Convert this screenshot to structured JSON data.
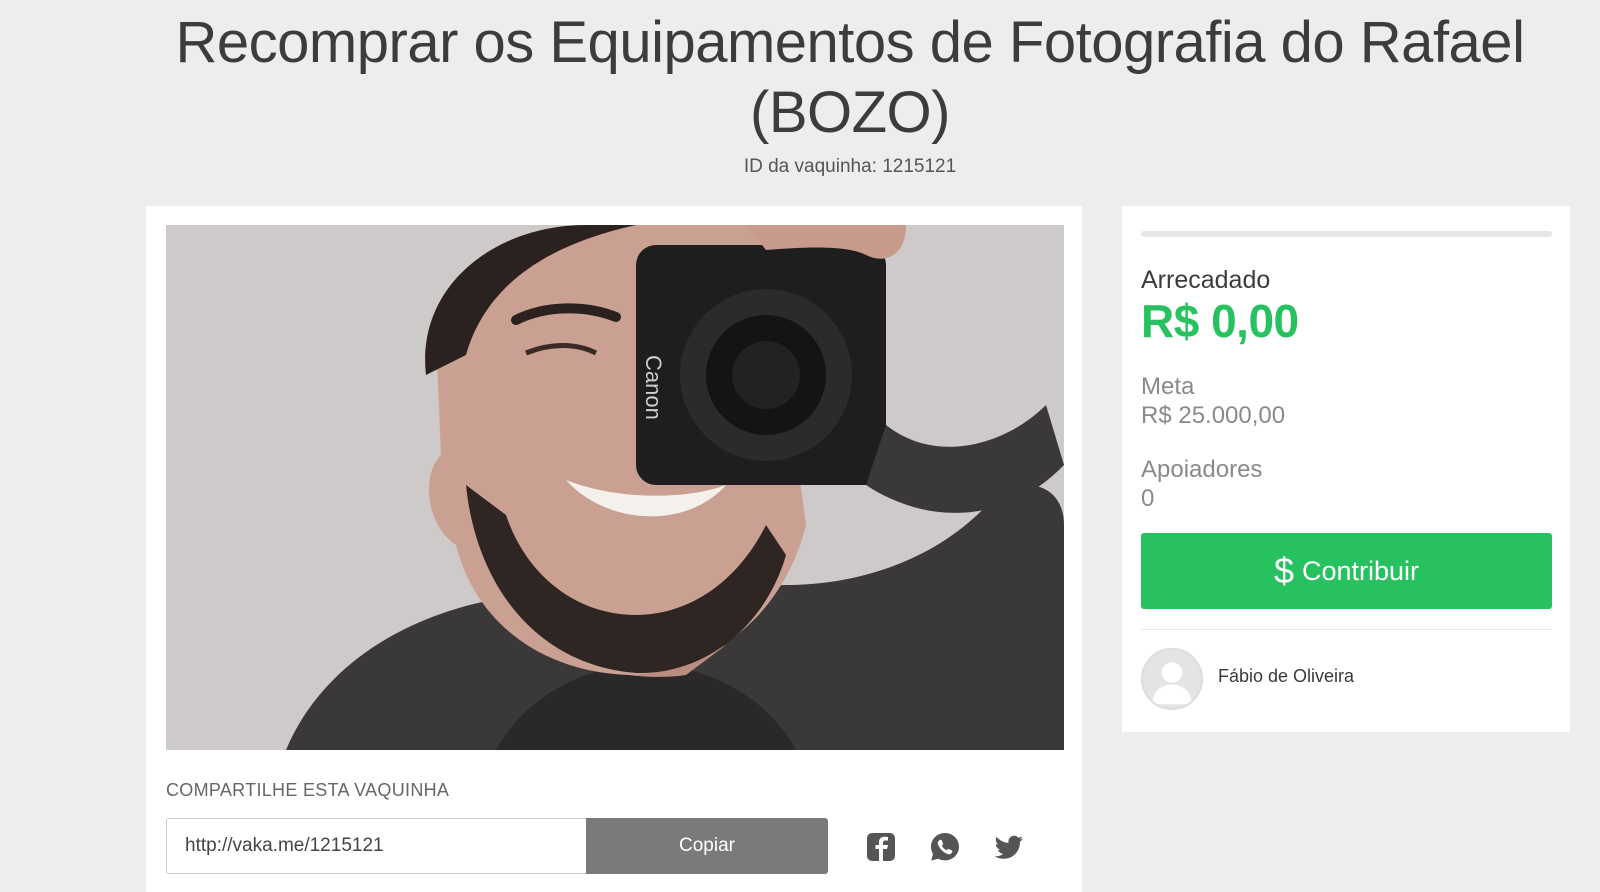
{
  "campaign": {
    "title": "Recomprar os Equipamentos de Fotografia do Rafael (BOZO)",
    "id_line": "ID da vaquinha: 1215121"
  },
  "share": {
    "label": "COMPARTILHE ESTA VAQUINHA",
    "url": "http://vaka.me/1215121",
    "copy_label": "Copiar",
    "icons": [
      "facebook-icon",
      "whatsapp-icon",
      "twitter-icon"
    ]
  },
  "stats": {
    "raised_label": "Arrecadado",
    "raised_value": "R$ 0,00",
    "goal_label": "Meta",
    "goal_value": "R$ 25.000,00",
    "supporters_label": "Apoiadores",
    "supporters_value": "0",
    "progress_fraction": 0
  },
  "actions": {
    "contribute_symbol": "$",
    "contribute_label": "Contribuir"
  },
  "organizer": {
    "name": "Fábio de Oliveira"
  },
  "colors": {
    "accent_green": "#27c25f",
    "copy_button": "#7a7a7a",
    "icon_gray": "#555555"
  }
}
